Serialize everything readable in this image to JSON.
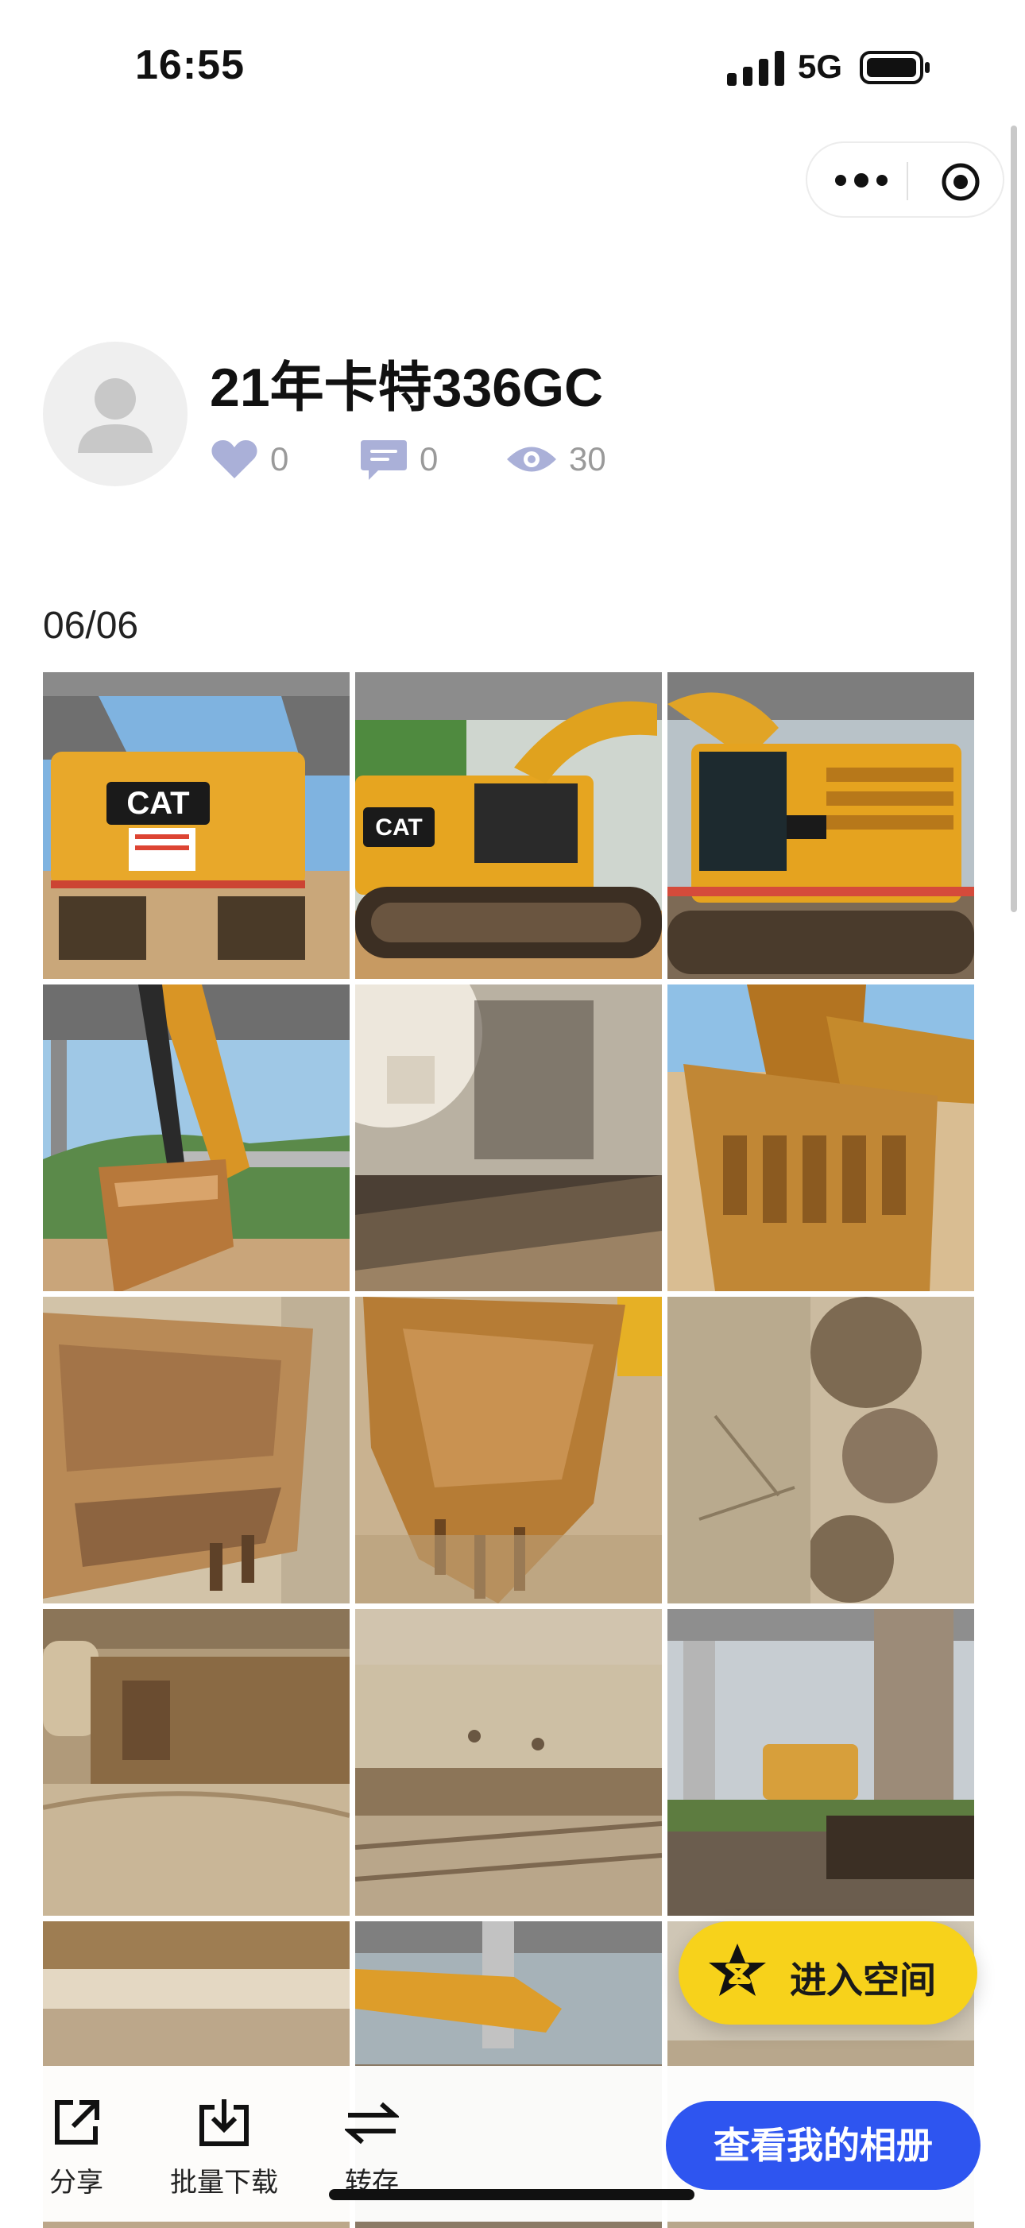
{
  "status_bar": {
    "time": "16:55",
    "network": "5G"
  },
  "album": {
    "title": "21年卡特336GC",
    "likes": "0",
    "comments": "0",
    "views": "30",
    "date": "06/06"
  },
  "photos": [
    {
      "name": "photo-1",
      "scene": "cat-rear"
    },
    {
      "name": "photo-2",
      "scene": "cat-side"
    },
    {
      "name": "photo-3",
      "scene": "cat-cab"
    },
    {
      "name": "photo-4",
      "scene": "arm-bridge"
    },
    {
      "name": "photo-5",
      "scene": "glare"
    },
    {
      "name": "photo-6",
      "scene": "bucket-teeth"
    },
    {
      "name": "photo-7",
      "scene": "bucket-close"
    },
    {
      "name": "photo-8",
      "scene": "bucket-hang"
    },
    {
      "name": "photo-9",
      "scene": "dirt-close"
    },
    {
      "name": "photo-10",
      "scene": "dirt-shelf"
    },
    {
      "name": "photo-11",
      "scene": "track-mud"
    },
    {
      "name": "photo-12",
      "scene": "rear-under"
    },
    {
      "name": "photo-13",
      "scene": "track-top"
    },
    {
      "name": "photo-14",
      "scene": "boom-bridge"
    },
    {
      "name": "photo-15",
      "scene": "partial"
    }
  ],
  "fab": {
    "label": "进入空间",
    "color": "#f7d21b"
  },
  "bottom_bar": {
    "share": "分享",
    "batch_download": "批量下载",
    "transfer": "转存",
    "view_album": "查看我的相册",
    "primary_color": "#2e55f0"
  }
}
